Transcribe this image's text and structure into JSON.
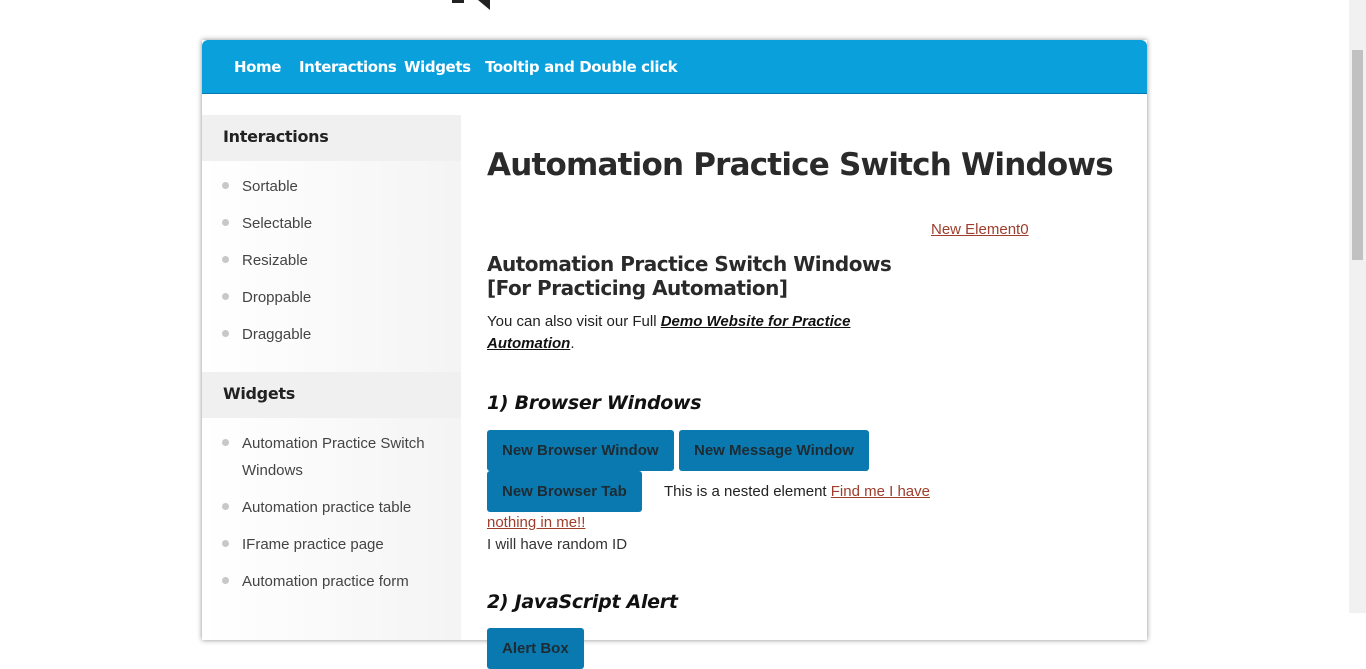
{
  "nav": {
    "items": [
      "Home",
      "Interactions",
      "Widgets",
      "Tooltip and Double click"
    ]
  },
  "sidebar": {
    "sections": [
      {
        "title": "Interactions",
        "items": [
          "Sortable",
          "Selectable",
          "Resizable",
          "Droppable",
          "Draggable"
        ]
      },
      {
        "title": "Widgets",
        "items": [
          "Automation Practice Switch Windows",
          "Automation practice table",
          "IFrame practice page",
          "Automation practice form"
        ]
      }
    ]
  },
  "main": {
    "title": "Automation Practice Switch Windows",
    "new_element_link": "New Element0",
    "subtitle": "Automation Practice Switch Windows [For Practicing Automation]",
    "visit_prefix": "You can also visit our Full ",
    "visit_link": "Demo Website for Practice Automation",
    "visit_suffix": ".",
    "section1_title": "1) Browser Windows",
    "buttons": {
      "new_browser_window": "New Browser Window",
      "new_message_window": "New Message Window",
      "new_browser_tab": "New Browser Tab"
    },
    "nested_text": "This is a nested element ",
    "nested_link_part1": "Find me I have",
    "nested_link_part2": "nothing in me!!",
    "random_id_text": "I will have random ID",
    "section2_title": "2) JavaScript Alert",
    "alert_box_button": "Alert Box"
  },
  "colors": {
    "navbar": "#0aa0dc",
    "button": "#0a79b0",
    "link": "#9e3d2b"
  }
}
